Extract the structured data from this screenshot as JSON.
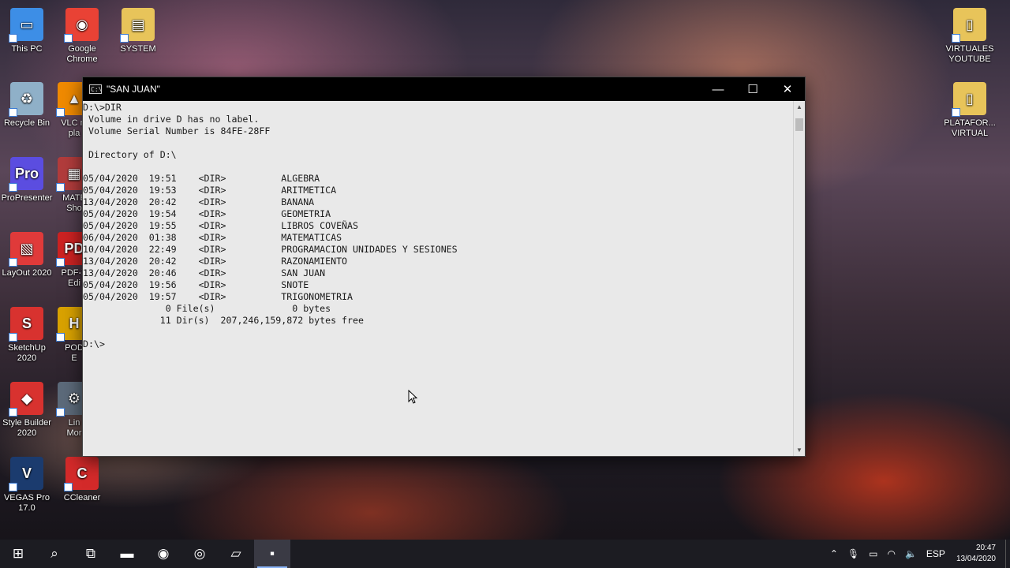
{
  "desktop": {
    "left_icons": [
      {
        "label": "This PC",
        "icon": "this-pc-icon",
        "color": "#3d8ee6",
        "glyph": "▭"
      },
      {
        "label": "Google\nChrome",
        "icon": "chrome-icon",
        "color": "#e94235",
        "glyph": "◉"
      },
      {
        "label": "SYSTEM",
        "icon": "folder-icon",
        "color": "#e8c45a",
        "glyph": "▤"
      },
      {
        "label": "Recycle Bin",
        "icon": "recycle-bin-icon",
        "color": "#8fb0c8",
        "glyph": "♻"
      },
      {
        "label": "VLC m\npla",
        "icon": "vlc-icon",
        "color": "#f08a00",
        "glyph": "▲"
      },
      {
        "label": "ProPresenter",
        "icon": "propresenter-icon",
        "color": "#5b4de0",
        "glyph": "Pro"
      },
      {
        "label": "MATE\nSho",
        "icon": "shortcut-icon",
        "color": "#b23c3c",
        "glyph": "▦"
      },
      {
        "label": "LayOut 2020",
        "icon": "layout-icon",
        "color": "#e03a3a",
        "glyph": "▧"
      },
      {
        "label": "PDF-X\nEdi",
        "icon": "pdf-icon",
        "color": "#c22",
        "glyph": "PD"
      },
      {
        "label": "SketchUp\n2020",
        "icon": "sketchup-icon",
        "color": "#d8322f",
        "glyph": "S"
      },
      {
        "label": "POD\nE",
        "icon": "pod-icon",
        "color": "#d9a200",
        "glyph": "H"
      },
      {
        "label": "Style Builder\n2020",
        "icon": "style-builder-icon",
        "color": "#d8322f",
        "glyph": "◆"
      },
      {
        "label": "Lin\nMor",
        "icon": "linmor-icon",
        "color": "#5c6a7a",
        "glyph": "⚙"
      },
      {
        "label": "VEGAS Pro\n17.0",
        "icon": "vegas-icon",
        "color": "#1b3b6e",
        "glyph": "V"
      },
      {
        "label": "CCleaner",
        "icon": "ccleaner-icon",
        "color": "#d42a2a",
        "glyph": "C"
      }
    ],
    "right_icons": [
      {
        "label": "VIRTUALES\nYOUTUBE",
        "icon": "folder-icon",
        "color": "#e8c45a",
        "glyph": "▯"
      },
      {
        "label": "PLATAFOR...\nVIRTUAL",
        "icon": "folder-icon",
        "color": "#e8c45a",
        "glyph": "▯"
      }
    ]
  },
  "console": {
    "title": "\"SAN JUAN\"",
    "lines": [
      "D:\\>DIR",
      " Volume in drive D has no label.",
      " Volume Serial Number is 84FE-28FF",
      "",
      " Directory of D:\\",
      "",
      "05/04/2020  19:51    <DIR>          ALGEBRA",
      "05/04/2020  19:53    <DIR>          ARITMETICA",
      "13/04/2020  20:42    <DIR>          BANANA",
      "05/04/2020  19:54    <DIR>          GEOMETRIA",
      "05/04/2020  19:55    <DIR>          LIBROS COVEÑAS",
      "06/04/2020  01:38    <DIR>          MATEMATICAS",
      "10/04/2020  22:49    <DIR>          PROGRAMACION UNIDADES Y SESIONES",
      "13/04/2020  20:42    <DIR>          RAZONAMIENTO",
      "13/04/2020  20:46    <DIR>          SAN JUAN",
      "05/04/2020  19:56    <DIR>          SNOTE",
      "05/04/2020  19:57    <DIR>          TRIGONOMETRIA",
      "               0 File(s)              0 bytes",
      "              11 Dir(s)  207,246,159,872 bytes free",
      "",
      "D:\\>"
    ]
  },
  "taskbar": {
    "buttons": [
      {
        "icon": "windows-start-icon",
        "glyph": "⊞"
      },
      {
        "icon": "search-icon",
        "glyph": "⌕"
      },
      {
        "icon": "task-view-icon",
        "glyph": "⧉"
      },
      {
        "icon": "file-explorer-icon",
        "glyph": "▬"
      },
      {
        "icon": "chrome-icon",
        "glyph": "◉"
      },
      {
        "icon": "obs-icon",
        "glyph": "◎"
      },
      {
        "icon": "notepad-icon",
        "glyph": "▱"
      },
      {
        "icon": "command-prompt-icon",
        "glyph": "▪"
      }
    ],
    "language": "ESP",
    "time": "20:47",
    "date": "13/04/2020"
  }
}
